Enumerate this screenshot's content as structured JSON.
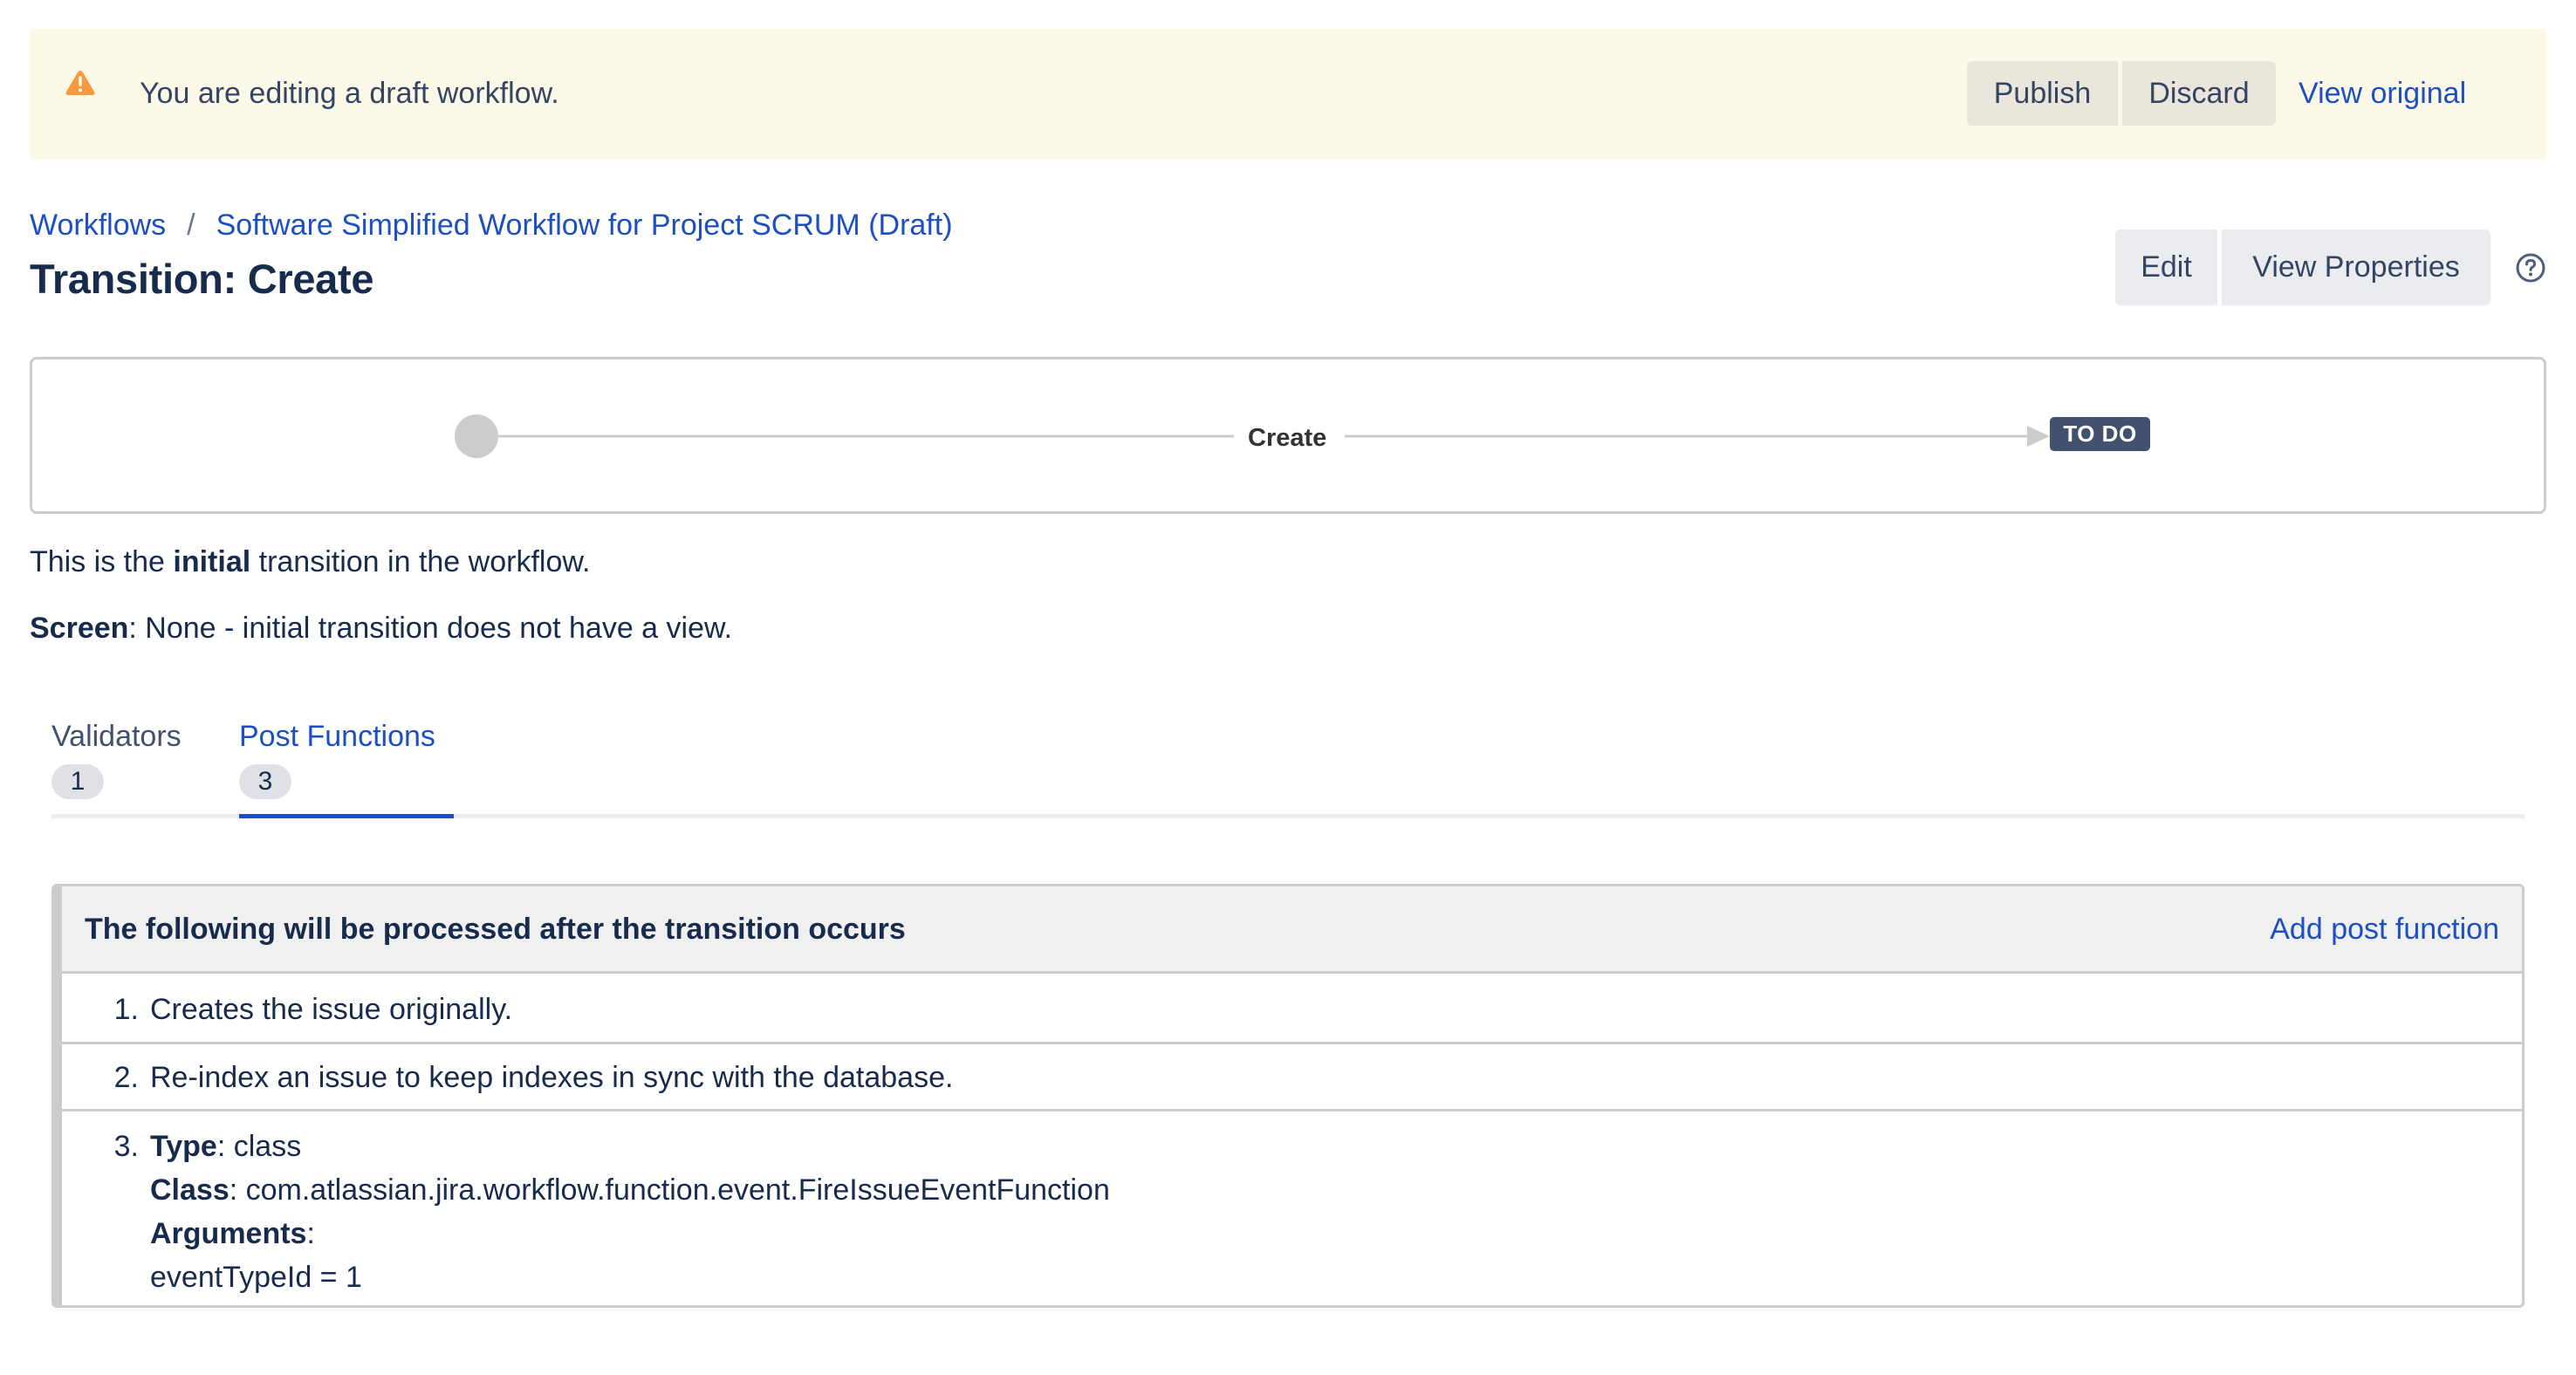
{
  "banner": {
    "icon": "warning-icon",
    "message": "You are editing a draft workflow.",
    "publish_label": "Publish",
    "discard_label": "Discard",
    "view_original_label": "View original",
    "colors": {
      "background": "#FCF9E8",
      "icon": "#F79A3E",
      "button": "#EAE6DB"
    }
  },
  "breadcrumb": {
    "items": [
      "Workflows",
      "Software Simplified Workflow for Project SCRUM (Draft)"
    ],
    "separator": "/"
  },
  "header": {
    "title": "Transition: Create",
    "edit_label": "Edit",
    "view_properties_label": "View Properties",
    "help_icon": "help-icon"
  },
  "diagram": {
    "transition_label": "Create",
    "target_status": "TO DO",
    "colors": {
      "line": "#CCCCCC",
      "status_badge": "#42526E"
    }
  },
  "description": {
    "line1": {
      "prefix": "This is the ",
      "bold": "initial",
      "suffix": " transition in the workflow."
    },
    "line2": {
      "label": "Screen",
      "value": ": None - initial transition does not have a view."
    }
  },
  "tabs": [
    {
      "label": "Validators",
      "count": "1",
      "active": false
    },
    {
      "label": "Post Functions",
      "count": "3",
      "active": true
    }
  ],
  "post_functions": {
    "heading": "The following will be processed after the transition occurs",
    "add_label": "Add post function",
    "items": [
      {
        "num": "1.",
        "text": "Creates the issue originally."
      },
      {
        "num": "2.",
        "text": "Re-index an issue to keep indexes in sync with the database."
      },
      {
        "num": "3.",
        "type_label": "Type",
        "type_value": ": class",
        "class_label": "Class",
        "class_value": ": com.atlassian.jira.workflow.function.event.FireIssueEventFunction",
        "arguments_label": "Arguments",
        "arguments_suffix": ":",
        "argument": "eventTypeId = 1"
      }
    ]
  },
  "theme": {
    "link": "#1D4FC4",
    "text": "#172B4D",
    "muted": "#42526E"
  }
}
